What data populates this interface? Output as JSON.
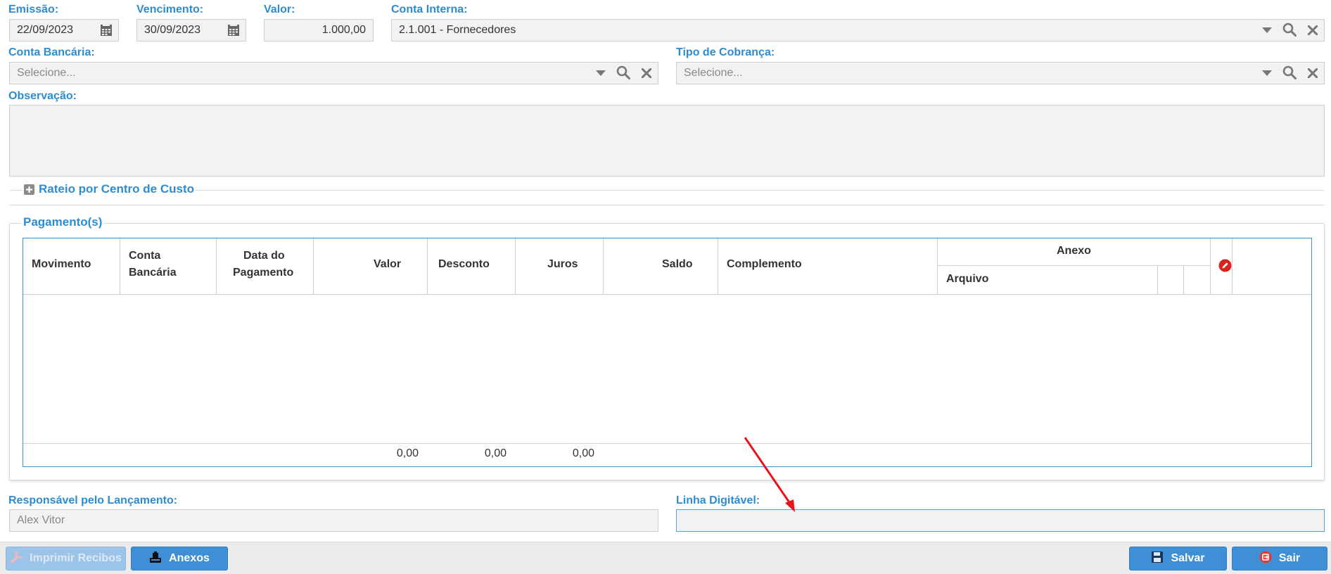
{
  "form": {
    "emissao": {
      "label": "Emissão:",
      "value": "22/09/2023"
    },
    "vencimento": {
      "label": "Vencimento:",
      "value": "30/09/2023"
    },
    "valor": {
      "label": "Valor:",
      "value": "1.000,00"
    },
    "conta_interna": {
      "label": "Conta Interna:",
      "value": "2.1.001 - Fornecedores"
    },
    "conta_bancaria": {
      "label": "Conta Bancária:",
      "placeholder": "Selecione..."
    },
    "tipo_cobranca": {
      "label": "Tipo de Cobrança:",
      "placeholder": "Selecione..."
    },
    "observacao": {
      "label": "Observação:",
      "value": ""
    },
    "rateio_label": "Rateio por Centro de Custo",
    "responsavel": {
      "label": "Responsável pelo Lançamento:",
      "placeholder": "Alex Vitor"
    },
    "linha_digitavel": {
      "label": "Linha Digitável:",
      "value": ""
    }
  },
  "pagamentos": {
    "legend": "Pagamento(s)",
    "columns": {
      "movimento": "Movimento",
      "conta_bancaria_1": "Conta",
      "conta_bancaria_2": "Bancária",
      "data_1": "Data do",
      "data_2": "Pagamento",
      "valor": "Valor",
      "desconto": "Desconto",
      "juros": "Juros",
      "saldo": "Saldo",
      "complemento": "Complemento",
      "anexo": "Anexo",
      "arquivo": "Arquivo"
    },
    "totals": {
      "valor": "0,00",
      "desconto": "0,00",
      "juros": "0,00"
    }
  },
  "footer": {
    "imprimir_recibos": "Imprimir Recibos",
    "anexos": "Anexos",
    "salvar": "Salvar",
    "sair": "Sair"
  },
  "colors": {
    "accent": "#2d8ccf",
    "button": "#3f8fd6",
    "annotation_arrow": "#e8141b",
    "edit_icon": "#d9241d"
  },
  "icons": [
    "calendar-icon",
    "dropdown-caret-icon",
    "search-icon",
    "clear-icon",
    "expand-plus-icon",
    "edit-icon",
    "pdf-icon",
    "attachment-icon",
    "save-icon",
    "exit-icon"
  ]
}
